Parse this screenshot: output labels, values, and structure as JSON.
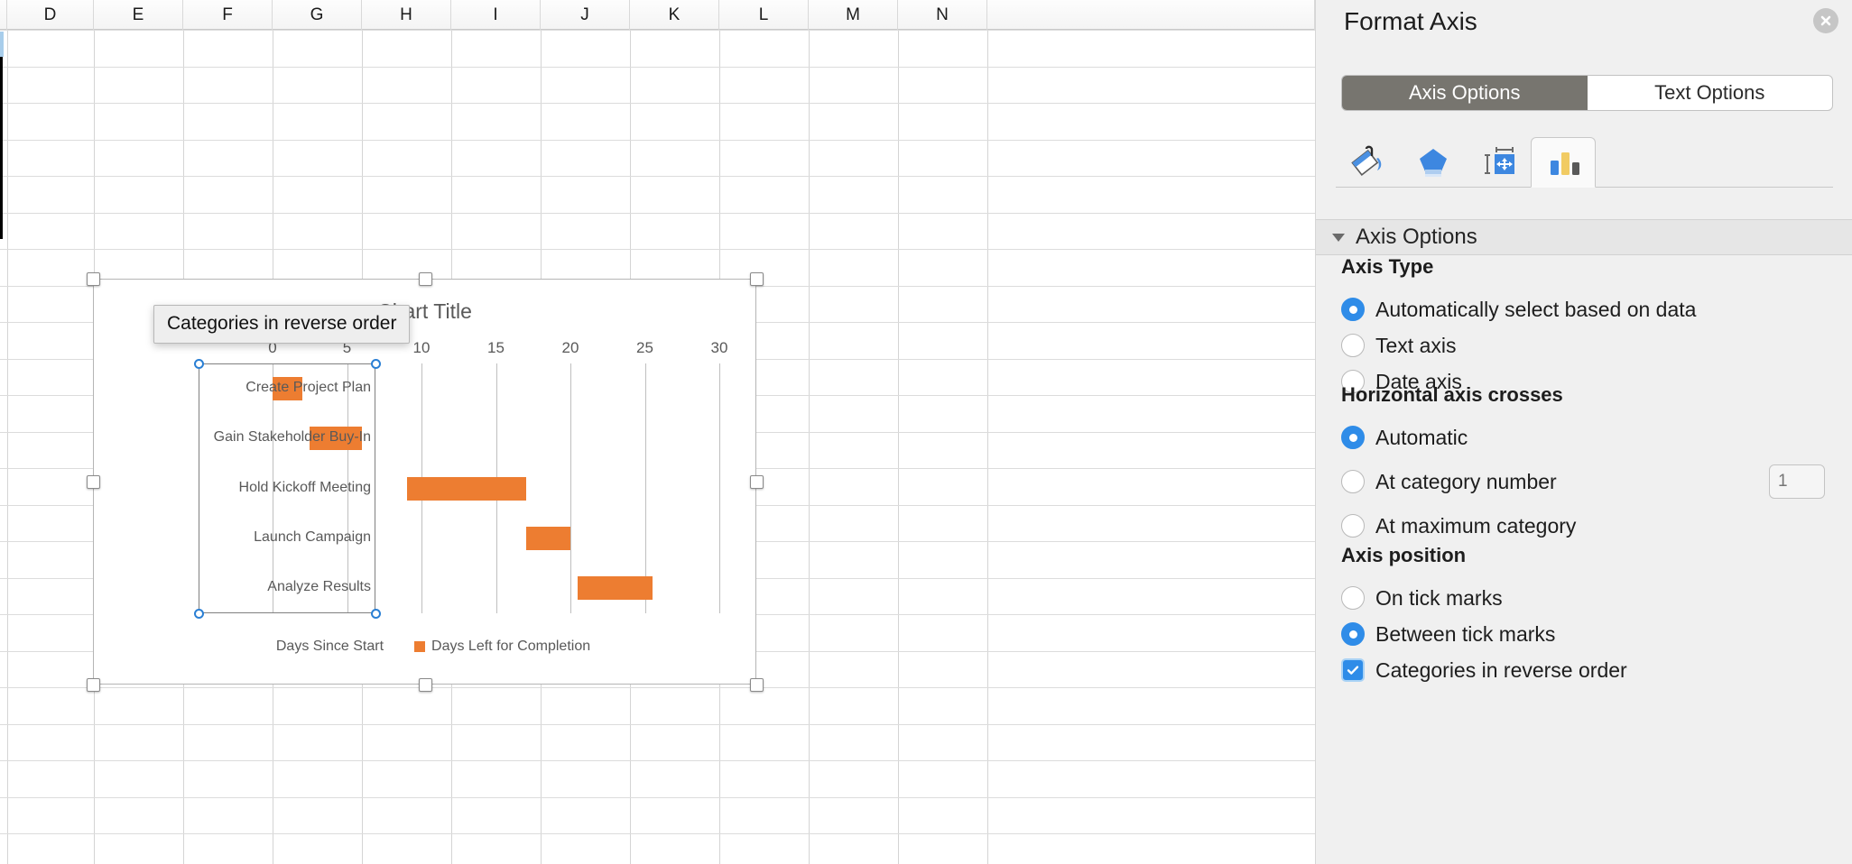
{
  "spreadsheet": {
    "columns": [
      "D",
      "E",
      "F",
      "G",
      "H",
      "I",
      "J",
      "K",
      "L",
      "M",
      "N"
    ]
  },
  "tooltip": {
    "text": "Categories in reverse order"
  },
  "chart_data": {
    "type": "bar",
    "title": "Chart Title",
    "xlabel": "",
    "ylabel": "",
    "orientation": "horizontal",
    "stacked": true,
    "grid": true,
    "legend_position": "bottom",
    "xlim": [
      0,
      30
    ],
    "xticks": [
      "0",
      "5",
      "10",
      "15",
      "20",
      "25",
      "30"
    ],
    "categories": [
      "Create Project Plan",
      "Gain Stakeholder Buy-In",
      "Hold Kickoff Meeting",
      "Launch Campaign",
      "Analyze Results"
    ],
    "series": [
      {
        "name": "Days Since Start",
        "color": "#FFFFFF",
        "visible_marker": false,
        "values": [
          0,
          2.5,
          9,
          17,
          20.5
        ]
      },
      {
        "name": "Days Left for Completion",
        "color": "#ED7D31",
        "visible_marker": true,
        "values": [
          2,
          3.5,
          8,
          3,
          5
        ]
      }
    ],
    "bars": [
      {
        "category": "Create Project Plan",
        "start": 0,
        "end": 2
      },
      {
        "category": "Gain Stakeholder Buy-In",
        "start": 2.5,
        "end": 6
      },
      {
        "category": "Hold Kickoff Meeting",
        "start": 9,
        "end": 17
      },
      {
        "category": "Launch Campaign",
        "start": 17,
        "end": 20
      },
      {
        "category": "Analyze Results",
        "start": 20.5,
        "end": 25.5
      }
    ]
  },
  "panel": {
    "title": "Format Axis",
    "close_icon": "close-icon",
    "tabs": [
      {
        "label": "Axis Options",
        "selected": true
      },
      {
        "label": "Text Options",
        "selected": false
      }
    ],
    "icon_tabs": [
      {
        "name": "fill-line-icon",
        "selected": false
      },
      {
        "name": "effects-icon",
        "selected": false
      },
      {
        "name": "size-properties-icon",
        "selected": false
      },
      {
        "name": "axis-options-chart-icon",
        "selected": true
      }
    ],
    "section": {
      "label": "Axis Options",
      "expanded": true
    },
    "groups": [
      {
        "title": "Axis Type",
        "options": [
          {
            "label": "Automatically select based on data",
            "type": "radio",
            "selected": true
          },
          {
            "label": "Text axis",
            "type": "radio",
            "selected": false
          },
          {
            "label": "Date axis",
            "type": "radio",
            "selected": false
          }
        ]
      },
      {
        "title": "Horizontal axis crosses",
        "options": [
          {
            "label": "Automatic",
            "type": "radio",
            "selected": true
          },
          {
            "label": "At category number",
            "type": "radio",
            "selected": false,
            "input_value": "1"
          },
          {
            "label": "At maximum category",
            "type": "radio",
            "selected": false
          }
        ]
      },
      {
        "title": "Axis position",
        "options": [
          {
            "label": "On tick marks",
            "type": "radio",
            "selected": false
          },
          {
            "label": "Between tick marks",
            "type": "radio",
            "selected": true
          },
          {
            "label": "Categories in reverse order",
            "type": "checkbox",
            "selected": true
          }
        ]
      }
    ]
  },
  "colors": {
    "accent_blue": "#2F8CE8",
    "bar_orange": "#ED7D31",
    "panel_bg": "#F0F0F0",
    "tab_selected": "#77756F"
  }
}
